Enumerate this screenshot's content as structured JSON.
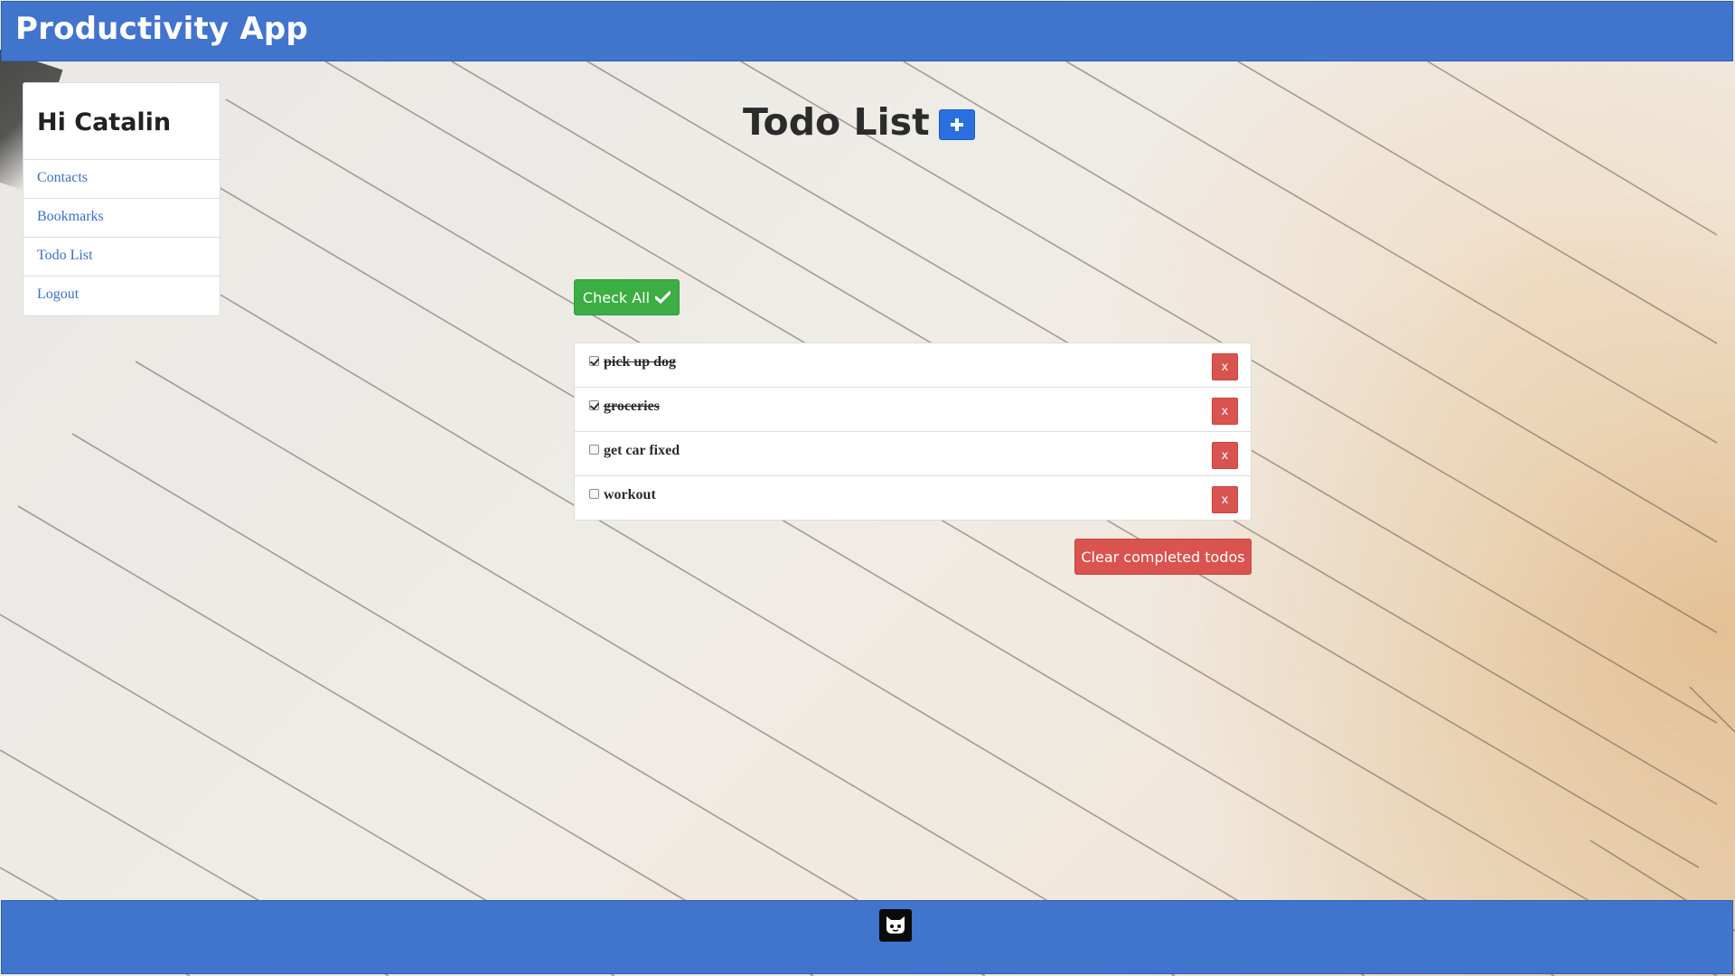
{
  "header": {
    "brand": "Productivity App"
  },
  "sidebar": {
    "greeting": "Hi Catalin",
    "items": [
      {
        "label": "Contacts"
      },
      {
        "label": "Bookmarks"
      },
      {
        "label": "Todo List"
      },
      {
        "label": "Logout"
      }
    ]
  },
  "main": {
    "title": "Todo List",
    "add_icon": "plus-icon",
    "check_all_label": "Check All",
    "check_all_icon": "checkmark-icon",
    "todos": [
      {
        "text": "pick up dog",
        "done": true,
        "delete_label": "x"
      },
      {
        "text": "groceries",
        "done": true,
        "delete_label": "x"
      },
      {
        "text": "get car fixed",
        "done": false,
        "delete_label": "x"
      },
      {
        "text": "workout",
        "done": false,
        "delete_label": "x"
      }
    ],
    "clear_label": "Clear completed todos"
  },
  "footer": {
    "icon": "github-icon"
  },
  "colors": {
    "navbar": "#4174cc",
    "link": "#3c6ec3",
    "success": "#3cae43",
    "danger": "#d9534f",
    "primary": "#2a6fe0"
  }
}
